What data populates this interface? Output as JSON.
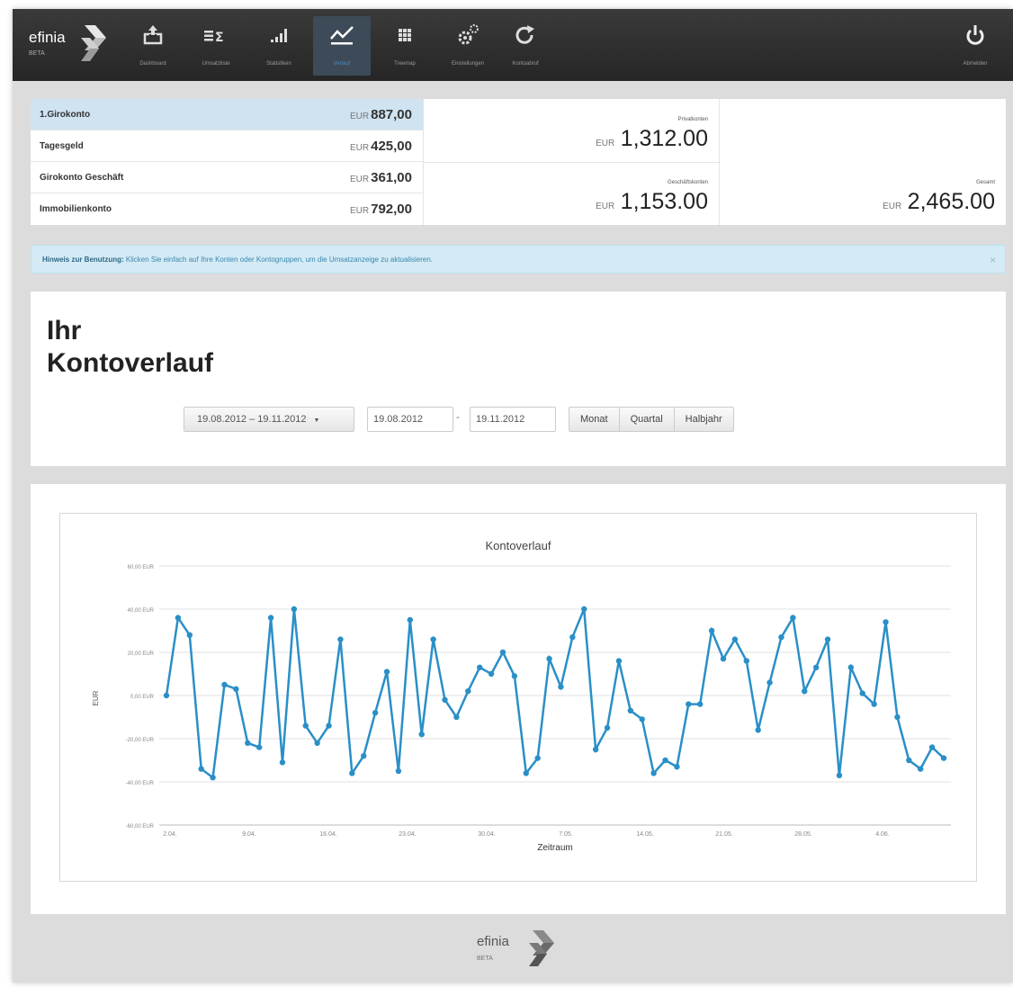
{
  "brand": {
    "name": "efinia",
    "tag": "BETA"
  },
  "nav": {
    "items": [
      {
        "label": "Dashboard",
        "icon": "inbox-upload-icon"
      },
      {
        "label": "Umsatzliste",
        "icon": "list-sum-icon"
      },
      {
        "label": "Statistiken",
        "icon": "bar-chart-icon"
      },
      {
        "label": "Verlauf",
        "icon": "line-chart-icon"
      },
      {
        "label": "Treemap",
        "icon": "grid-icon"
      },
      {
        "label": "Einstellungen",
        "icon": "gears-icon"
      },
      {
        "label": "Kontoabruf",
        "icon": "refresh-icon"
      }
    ],
    "logout": {
      "label": "Abmelden",
      "icon": "power-icon"
    }
  },
  "accounts": [
    {
      "name": "1.Girokonto",
      "currency": "EUR",
      "amount": "887,00",
      "selected": true
    },
    {
      "name": "Tagesgeld",
      "currency": "EUR",
      "amount": "425,00"
    },
    {
      "name": "Girokonto Geschäft",
      "currency": "EUR",
      "amount": "361,00"
    },
    {
      "name": "Immobilienkonto",
      "currency": "EUR",
      "amount": "792,00"
    }
  ],
  "groups": {
    "private": {
      "label": "Privatkonten",
      "currency": "EUR",
      "amount": "1,312.00"
    },
    "business": {
      "label": "Geschäftskonten",
      "currency": "EUR",
      "amount": "1,153.00"
    },
    "total": {
      "label": "Gesamt",
      "currency": "EUR",
      "amount": "2,465.00"
    }
  },
  "alert": {
    "heading": "Hinweis zur Benutzung:",
    "text": "Klicken Sie einfach auf Ihre Konten oder Kontogruppen, um die Umsatzanzeige zu aktualisieren.",
    "close": "×"
  },
  "range": {
    "title_line1": "Ihr",
    "title_line2": "Kontoverlauf",
    "dropdown_value": "19.08.2012 – 19.11.2012",
    "dropdown_caret": "▼",
    "from": "19.08.2012",
    "separator": "-",
    "to": "19.11.2012",
    "buttons": [
      "Monat",
      "Quartal",
      "Halbjahr"
    ]
  },
  "chart_data": {
    "type": "line",
    "title": "Kontoverlauf",
    "xlabel": "Zeitraum",
    "ylabel": "EUR",
    "ylim": [
      -60,
      60
    ],
    "yticks": [
      -60,
      -40,
      -20,
      0,
      20,
      40,
      60
    ],
    "ytick_labels": [
      "-60,00 EUR",
      "-40,00 EUR",
      "-20,00 EUR",
      "0,00 EUR",
      "20,00 EUR",
      "40,00 EUR",
      "60,00 EUR"
    ],
    "xtick_labels": [
      "2.04.",
      "9.04.",
      "16.04.",
      "23.04.",
      "30.04.",
      "7.05.",
      "14.05.",
      "21.05.",
      "28.05.",
      "4.06."
    ],
    "grid": true,
    "color": "#2a8fc7",
    "values": [
      0,
      36,
      28,
      -34,
      -38,
      5,
      3,
      -22,
      -24,
      36,
      -31,
      40,
      -14,
      -22,
      -14,
      26,
      -36,
      -28,
      -8,
      11,
      -35,
      35,
      -18,
      26,
      -2,
      -10,
      2,
      13,
      10,
      20,
      9,
      -36,
      -29,
      17,
      4,
      27,
      40,
      -25,
      -15,
      16,
      -7,
      -11,
      -36,
      -30,
      -33,
      -4,
      -4,
      30,
      17,
      26,
      16,
      -16,
      6,
      27,
      36,
      2,
      13,
      26,
      -37,
      13,
      1,
      -4,
      34,
      -10,
      -30,
      -34,
      -24,
      -29
    ]
  },
  "footer": {
    "name": "efinia",
    "tag": "BETA"
  }
}
